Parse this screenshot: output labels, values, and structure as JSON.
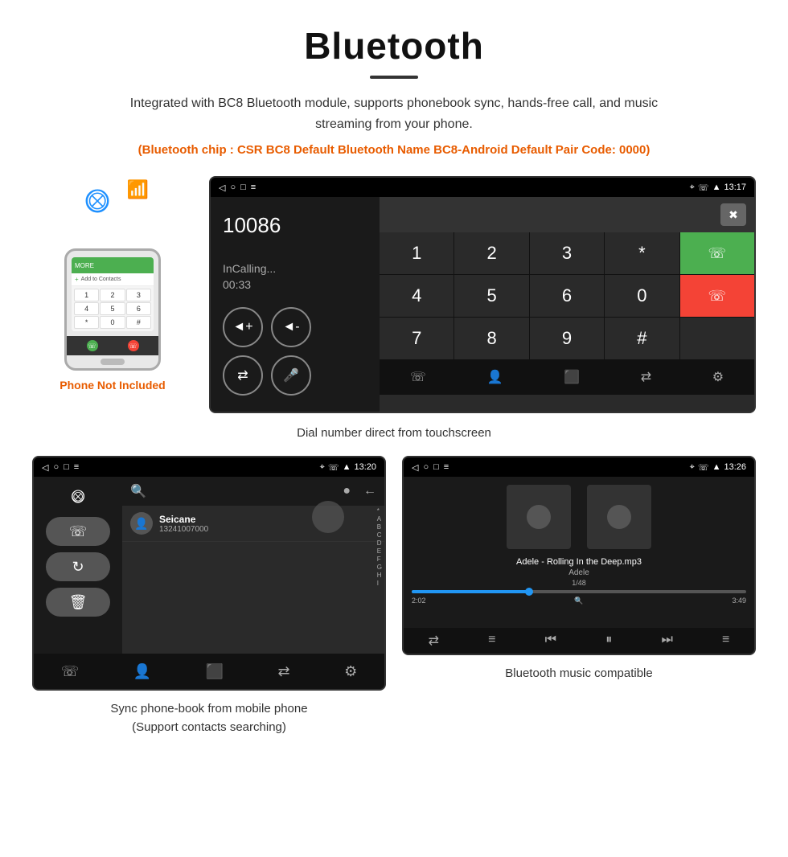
{
  "header": {
    "title": "Bluetooth",
    "description": "Integrated with BC8 Bluetooth module, supports phonebook sync, hands-free call, and music streaming from your phone.",
    "specs": "(Bluetooth chip : CSR BC8    Default Bluetooth Name BC8-Android    Default Pair Code: 0000)"
  },
  "dial_screen": {
    "status_time": "13:17",
    "dialed_number": "10086",
    "call_status": "InCalling...",
    "call_timer": "00:33",
    "keypad": [
      "1",
      "2",
      "3",
      "*",
      "",
      "4",
      "5",
      "6",
      "0",
      "",
      "7",
      "8",
      "9",
      "#",
      ""
    ],
    "caption": "Dial number direct from touchscreen"
  },
  "contacts_screen": {
    "status_time": "13:20",
    "contact_name": "Seicane",
    "contact_number": "13241007000",
    "alphabet": [
      "*",
      "A",
      "B",
      "C",
      "D",
      "E",
      "F",
      "G",
      "H",
      "I"
    ],
    "search_placeholder": "Search",
    "caption_line1": "Sync phone-book from mobile phone",
    "caption_line2": "(Support contacts searching)"
  },
  "music_screen": {
    "status_time": "13:26",
    "song_title": "Adele - Rolling In the Deep.mp3",
    "artist": "Adele",
    "track_info": "1/48",
    "time_current": "2:02",
    "time_total": "3:49",
    "progress_pct": 35,
    "caption": "Bluetooth music compatible"
  },
  "phone_illustration": {
    "not_included_label": "Phone Not Included"
  }
}
